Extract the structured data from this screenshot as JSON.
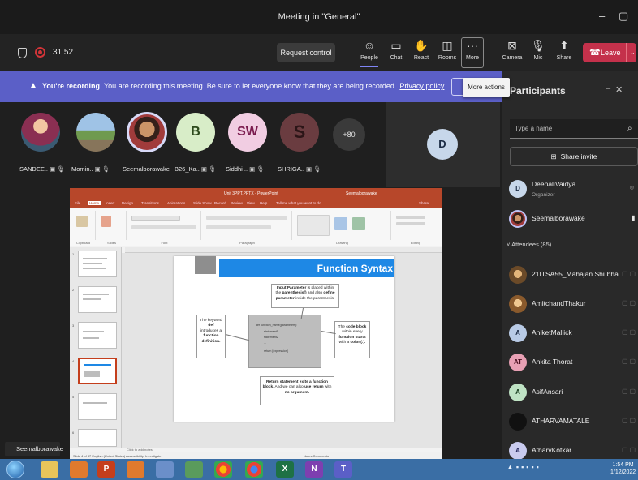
{
  "window": {
    "title": "Meeting in \"General\"",
    "minimize": "–",
    "maximize": "▢"
  },
  "toolbar": {
    "timer": "31:52",
    "request_control": "Request control",
    "buttons": [
      {
        "label": "People",
        "icon": "people-icon"
      },
      {
        "label": "Chat",
        "icon": "chat-icon"
      },
      {
        "label": "React",
        "icon": "react-icon"
      },
      {
        "label": "Rooms",
        "icon": "rooms-icon"
      },
      {
        "label": "More",
        "icon": "more-icon"
      },
      {
        "label": "Camera",
        "icon": "camera-off-icon"
      },
      {
        "label": "Mic",
        "icon": "mic-off-icon"
      },
      {
        "label": "Share",
        "icon": "share-icon"
      }
    ],
    "leave": "Leave",
    "tooltip": "More actions"
  },
  "banner": {
    "bold": "You're recording",
    "text": "You are recording this meeting. Be sure to let everyone know that they are being recorded.",
    "link": "Privacy policy"
  },
  "strip": {
    "participants": [
      {
        "name": "SANDEE..",
        "initials": "",
        "kind": "photo"
      },
      {
        "name": "Momin..",
        "initials": "",
        "kind": "photo"
      },
      {
        "name": "Seemalborawake",
        "initials": "",
        "kind": "photo"
      },
      {
        "name": "B26_Ka..",
        "initials": "B",
        "kind": "initials"
      },
      {
        "name": "Siddhi ..",
        "initials": "SW",
        "kind": "initials"
      },
      {
        "name": "SHRIGA..",
        "initials": "S",
        "kind": "initials"
      }
    ],
    "overflow": "+80",
    "tile_initials": "D"
  },
  "presentation": {
    "window_title": "Unit 3PPT.PPTX - PowerPoint",
    "user": "Seemalborawake",
    "tabs": [
      "File",
      "Home",
      "Insert",
      "Design",
      "Transitions",
      "Animations",
      "Slide Show",
      "Record",
      "Review",
      "View",
      "Help",
      "Tell me what you want to do",
      "Share"
    ],
    "groups": [
      "Clipboard",
      "Slides",
      "Font",
      "Paragraph",
      "Drawing",
      "Editing"
    ],
    "slide": {
      "title": "Function Syntax",
      "callout_top": {
        "pre": "Input Parameter",
        "mid1": " is placed within the ",
        "b1": "parenthesis()",
        "mid2": " and also ",
        "b2": "define parameter",
        "post": " inside the parenthesis."
      },
      "callout_left": {
        "pre": "The keyword ",
        "b1": "def",
        "mid": " introduces a ",
        "b2": "function definition."
      },
      "callout_right": {
        "pre": "The ",
        "b1": "code block",
        "mid": " within every ",
        "b2": "function starts",
        "post": " with a ",
        "b3": "colon(:)."
      },
      "callout_bottom": {
        "b1": "Return statement exits a function block",
        "mid": ". And we can also ",
        "b2": "use return",
        "post": " with ",
        "b3": "no argument."
      },
      "code_lines": [
        "def function_name(parameters):",
        "statement1",
        "statement2",
        "...",
        "return [expression]"
      ]
    },
    "notes": "Click to add notes",
    "status_left": "Slide 4 of 37   English (United States)   Accessibility: Investigate",
    "status_right": "Notes   Comments"
  },
  "sharer_label": "Seemalborawake",
  "panel": {
    "title": "Participants",
    "search_placeholder": "Type a name",
    "share_invite": "Share invite",
    "organizers": [
      {
        "name": "DeepaliVaidya",
        "role": "Organizer",
        "initials": "D",
        "color": "#c7d7ea",
        "fg": "#1a2b44"
      },
      {
        "name": "Seemalborawake",
        "role": "",
        "initials": "",
        "color": "#d9a37c",
        "fg": "#000"
      }
    ],
    "attendees_header": "Attendees (85)",
    "attendees": [
      {
        "name": "21ITSA55_Mahajan Shubha...",
        "initials": "",
        "color": "#b5894f",
        "fg": "#fff"
      },
      {
        "name": "AmitchandThakur",
        "initials": "",
        "color": "#c49a5a",
        "fg": "#fff"
      },
      {
        "name": "AniketMallick",
        "initials": "A",
        "color": "#b9cbe6",
        "fg": "#1b2a44"
      },
      {
        "name": "Ankita Thorat",
        "initials": "AT",
        "color": "#e8a0b4",
        "fg": "#4a1020"
      },
      {
        "name": "AsifAnsari",
        "initials": "A",
        "color": "#bfe3c4",
        "fg": "#143a1b"
      },
      {
        "name": "ATHARVAMATALE",
        "initials": "",
        "color": "#111111",
        "fg": "#fff"
      },
      {
        "name": "AtharvKotkar",
        "initials": "A",
        "color": "#c9cbef",
        "fg": "#1f2157"
      }
    ]
  },
  "taskbar": {
    "clock_time": "1:54 PM",
    "clock_date": "1/12/2022"
  },
  "colors": {
    "accent": "#5b5fc7",
    "leave": "#c4314b",
    "slide_banner": "#1e88e5",
    "ppt": "#b7472a"
  }
}
